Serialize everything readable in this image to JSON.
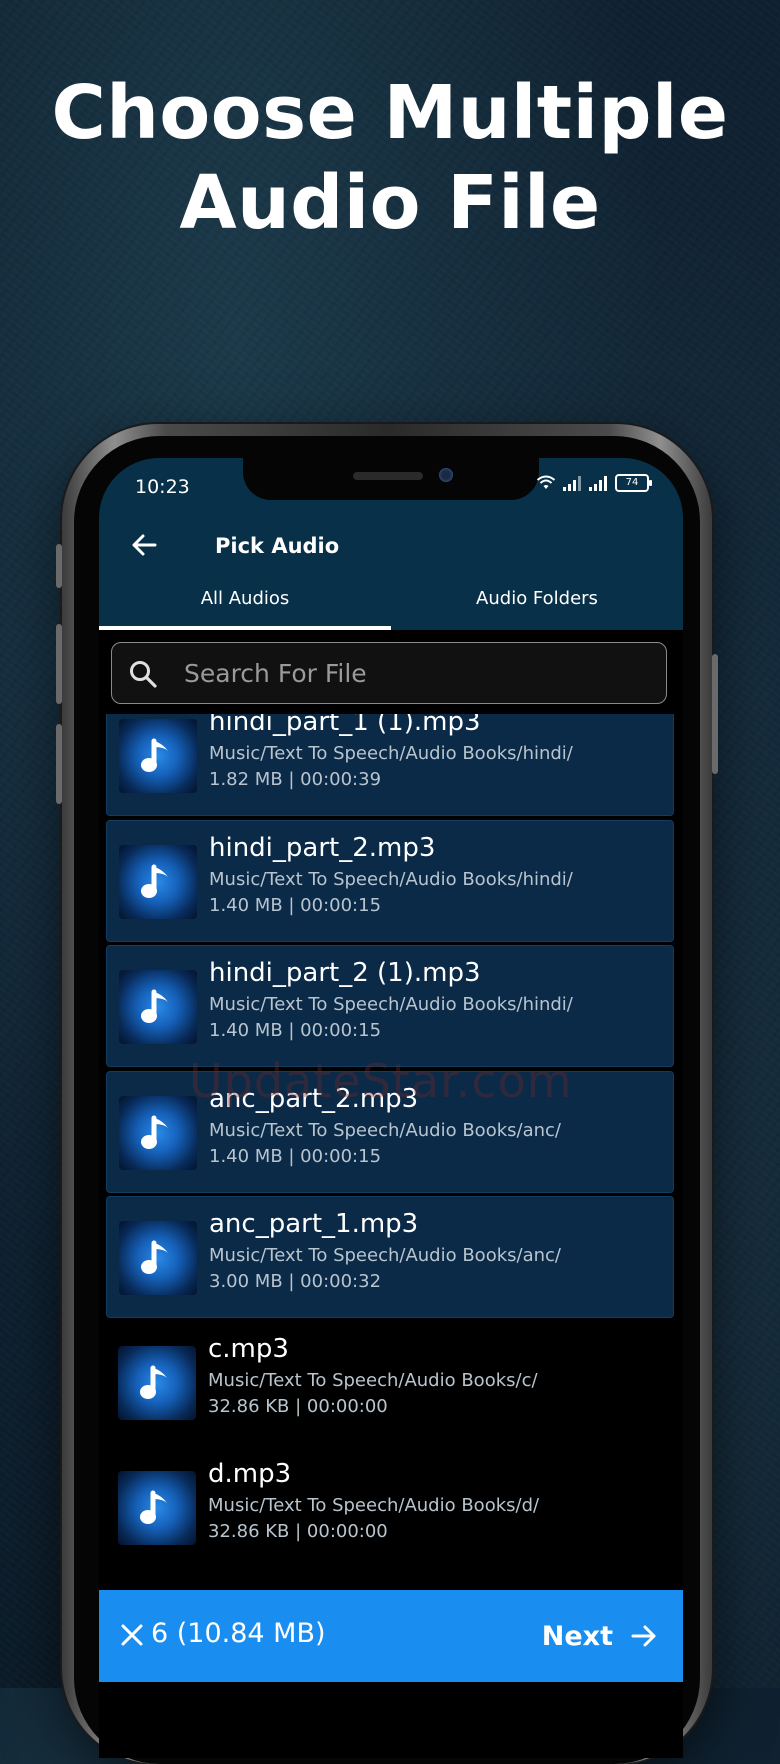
{
  "headline": {
    "line1": "Choose Multiple",
    "line2": "Audio File"
  },
  "status_bar": {
    "time": "10:23",
    "battery": "74"
  },
  "appbar": {
    "back_icon": "arrow-left-icon",
    "title": "Pick Audio"
  },
  "tabs": [
    {
      "label": "All Audios",
      "active": true
    },
    {
      "label": "Audio Folders",
      "active": false
    }
  ],
  "search": {
    "placeholder": "Search For File",
    "icon": "search-icon"
  },
  "files": [
    {
      "name": "hindi_part_1 (1).mp3",
      "path": "Music/Text To Speech/Audio Books/hindi/",
      "meta": "1.82 MB | 00:00:39",
      "selected": true
    },
    {
      "name": "hindi_part_2.mp3",
      "path": "Music/Text To Speech/Audio Books/hindi/",
      "meta": "1.40 MB | 00:00:15",
      "selected": true
    },
    {
      "name": "hindi_part_2 (1).mp3",
      "path": "Music/Text To Speech/Audio Books/hindi/",
      "meta": "1.40 MB | 00:00:15",
      "selected": true
    },
    {
      "name": "anc_part_2.mp3",
      "path": "Music/Text To Speech/Audio Books/anc/",
      "meta": "1.40 MB | 00:00:15",
      "selected": true
    },
    {
      "name": "anc_part_1.mp3",
      "path": "Music/Text To Speech/Audio Books/anc/",
      "meta": "3.00 MB | 00:00:32",
      "selected": true
    },
    {
      "name": "c.mp3",
      "path": "Music/Text To Speech/Audio Books/c/",
      "meta": "32.86 KB | 00:00:00",
      "selected": false
    },
    {
      "name": "d.mp3",
      "path": "Music/Text To Speech/Audio Books/d/",
      "meta": "32.86 KB | 00:00:00",
      "selected": false
    }
  ],
  "watermark": "UpdateStar.com",
  "bottom_bar": {
    "selection": "6 (10.84 MB)",
    "next_label": "Next",
    "clear_icon": "close-icon",
    "next_icon": "arrow-right-icon"
  },
  "colors": {
    "app_header": "#083048",
    "selected_row": "#0a2a48",
    "accent": "#1a8ef0"
  }
}
